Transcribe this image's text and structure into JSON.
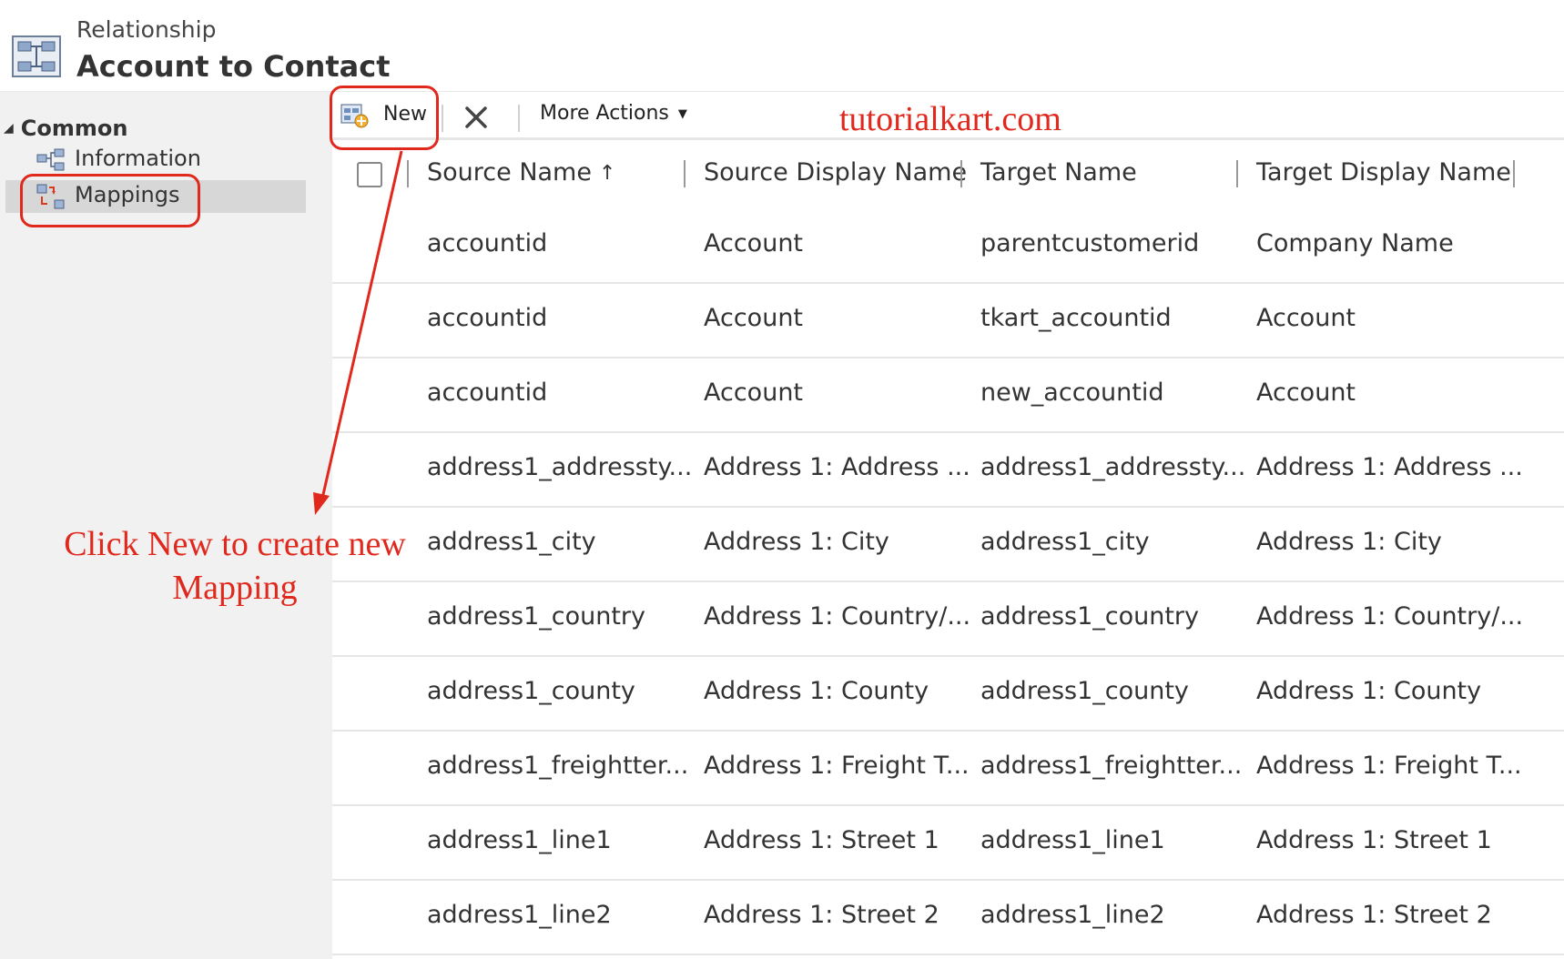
{
  "header": {
    "subtitle": "Relationship",
    "title": "Account to Contact"
  },
  "sidebar": {
    "group_label": "Common",
    "items": [
      {
        "label": "Information",
        "icon": "information-icon",
        "selected": false
      },
      {
        "label": "Mappings",
        "icon": "mappings-icon",
        "selected": true
      }
    ]
  },
  "toolbar": {
    "new_label": "New",
    "delete_icon": "close-x-icon",
    "more_actions_label": "More Actions"
  },
  "watermark": "tutorialkart.com",
  "grid": {
    "columns": [
      "Source Name",
      "Source Display Name",
      "Target Name",
      "Target Display Name"
    ],
    "sort_column": "Source Name",
    "sort_direction": "ascending",
    "rows": [
      [
        "accountid",
        "Account",
        "parentcustomerid",
        "Company Name"
      ],
      [
        "accountid",
        "Account",
        "tkart_accountid",
        "Account"
      ],
      [
        "accountid",
        "Account",
        "new_accountid",
        "Account"
      ],
      [
        "address1_addressty...",
        "Address 1: Address ...",
        "address1_addressty...",
        "Address 1: Address ..."
      ],
      [
        "address1_city",
        "Address 1: City",
        "address1_city",
        "Address 1: City"
      ],
      [
        "address1_country",
        "Address 1: Country/...",
        "address1_country",
        "Address 1: Country/..."
      ],
      [
        "address1_county",
        "Address 1: County",
        "address1_county",
        "Address 1: County"
      ],
      [
        "address1_freightter...",
        "Address 1: Freight T...",
        "address1_freightter...",
        "Address 1: Freight T..."
      ],
      [
        "address1_line1",
        "Address 1: Street 1",
        "address1_line1",
        "Address 1: Street 1"
      ],
      [
        "address1_line2",
        "Address 1: Street 2",
        "address1_line2",
        "Address 1: Street 2"
      ]
    ]
  },
  "annotation": {
    "line1": "Click New to create new",
    "line2": "Mapping",
    "color": "#e0281c"
  }
}
